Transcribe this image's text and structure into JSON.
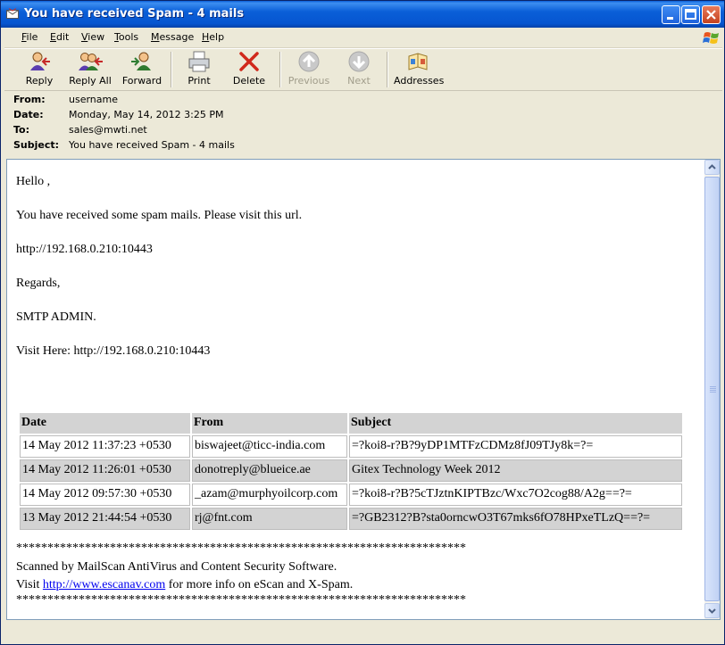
{
  "window": {
    "title": "You have received Spam - 4 mails"
  },
  "menu": [
    {
      "label": "File",
      "key": "F",
      "rest": "ile"
    },
    {
      "label": "Edit",
      "key": "E",
      "rest": "dit"
    },
    {
      "label": "View",
      "key": "V",
      "rest": "iew"
    },
    {
      "label": "Tools",
      "key": "T",
      "rest": "ools"
    },
    {
      "label": "Message",
      "key": "M",
      "rest": "essage"
    },
    {
      "label": "Help",
      "key": "H",
      "rest": "elp"
    }
  ],
  "toolbar": {
    "reply": "Reply",
    "reply_all": "Reply All",
    "forward": "Forward",
    "print": "Print",
    "delete": "Delete",
    "previous": "Previous",
    "next": "Next",
    "addresses": "Addresses"
  },
  "header": {
    "from_label": "From:",
    "from": "username",
    "date_label": "Date:",
    "date": "Monday, May 14, 2012 3:25 PM",
    "to_label": "To:",
    "to": "sales@mwti.net",
    "subject_label": "Subject:",
    "subject": "You have received Spam - 4 mails"
  },
  "body": {
    "greeting": "Hello ,",
    "line1": "You have received some spam mails. Please visit this url.",
    "url": "http://192.168.0.210:10443",
    "regards": "Regards,",
    "signature": "SMTP ADMIN.",
    "visit_here": "Visit Here: http://192.168.0.210:10443",
    "table": {
      "headers": [
        "Date",
        "From",
        "Subject"
      ],
      "rows": [
        [
          "14 May 2012 11:37:23 +0530",
          "biswajeet@ticc-india.com",
          "=?koi8-r?B?9yDP1MTFzCDMz8fJ09TJy8k=?="
        ],
        [
          "14 May 2012 11:26:01 +0530",
          "donotreply@blueice.ae",
          "Gitex Technology Week 2012"
        ],
        [
          "14 May 2012 09:57:30 +0530",
          "_azam@murphyoilcorp.com",
          "=?koi8-r?B?5cTJztnKIPTBzc/Wxc7O2cog88/A2g==?="
        ],
        [
          "13 May 2012 21:44:54 +0530",
          "rj@fnt.com",
          "=?GB2312?B?sta0orncwO3T67mks6fO78HPxeTLzQ==?="
        ]
      ]
    },
    "stars": "************************************************************************",
    "footer1": "Scanned by MailScan AntiVirus and Content Security Software.",
    "footer2_pre": "Visit ",
    "footer2_link": "http://www.escanav.com",
    "footer2_post": " for more info on eScan and X-Spam."
  },
  "colors": {
    "titlebar": "#0a5fd8",
    "chrome": "#ece9d8",
    "table_header": "#d3d3d3",
    "link": "#0000ee"
  }
}
